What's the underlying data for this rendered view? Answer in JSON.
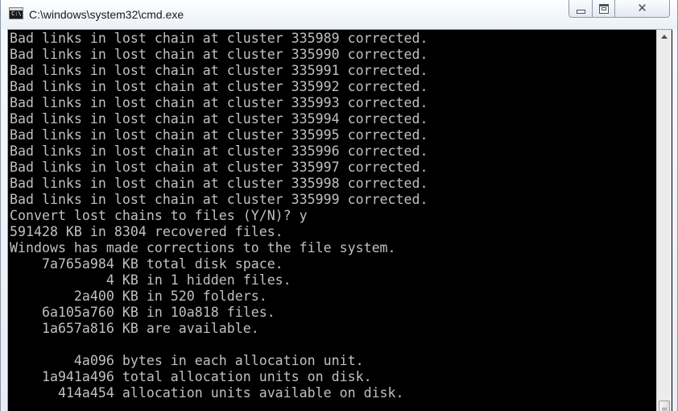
{
  "window": {
    "title": "C:\\windows\\system32\\cmd.exe",
    "app_icon": "cmd-icon",
    "app_icon_glyph": "C:\\",
    "buttons": {
      "minimize_icon": "minimize-icon",
      "maximize_icon": "maximize-icon",
      "close_icon": "close-icon",
      "close_glyph": "✕"
    }
  },
  "console": {
    "background": "#000000",
    "foreground": "#c0c0c0",
    "lines": [
      "Bad links in lost chain at cluster 335989 corrected.",
      "Bad links in lost chain at cluster 335990 corrected.",
      "Bad links in lost chain at cluster 335991 corrected.",
      "Bad links in lost chain at cluster 335992 corrected.",
      "Bad links in lost chain at cluster 335993 corrected.",
      "Bad links in lost chain at cluster 335994 corrected.",
      "Bad links in lost chain at cluster 335995 corrected.",
      "Bad links in lost chain at cluster 335996 corrected.",
      "Bad links in lost chain at cluster 335997 corrected.",
      "Bad links in lost chain at cluster 335998 corrected.",
      "Bad links in lost chain at cluster 335999 corrected.",
      "Convert lost chains to files (Y/N)? y",
      "591428 KB in 8304 recovered files.",
      "Windows has made corrections to the file system.",
      "    7a765a984 KB total disk space.",
      "            4 KB in 1 hidden files.",
      "        2a400 KB in 520 folders.",
      "    6a105a760 KB in 10a818 files.",
      "    1a657a816 KB are available.",
      "",
      "        4a096 bytes in each allocation unit.",
      "    1a941a496 total allocation units on disk.",
      "      414a454 allocation units available on disk."
    ]
  },
  "scrollbar": {
    "up_icon": "scroll-up-arrow-icon",
    "position": "bottom"
  }
}
